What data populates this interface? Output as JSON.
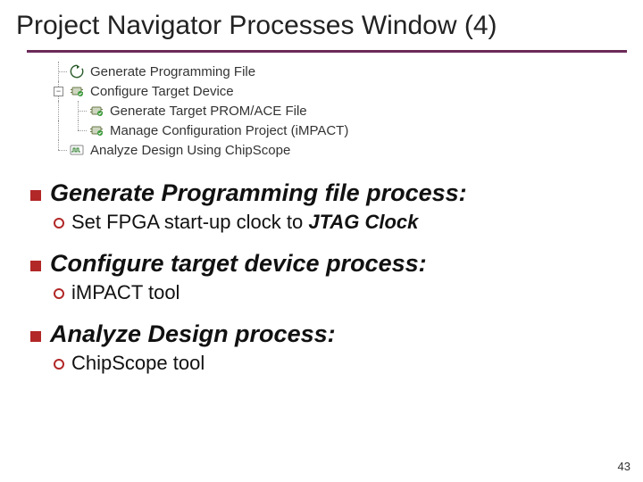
{
  "title": "Project Navigator Processes Window (4)",
  "tree": {
    "items": [
      {
        "label": "Generate Programming File",
        "icon": "cycle-icon"
      },
      {
        "label": "Configure Target Device",
        "icon": "chip-icon",
        "expanded": true,
        "children": [
          {
            "label": "Generate Target PROM/ACE File",
            "icon": "chip-icon"
          },
          {
            "label": "Manage Configuration Project (iMPACT)",
            "icon": "chip-icon"
          }
        ]
      },
      {
        "label": "Analyze Design Using ChipScope",
        "icon": "wave-icon"
      }
    ]
  },
  "bullets": [
    {
      "label_bold": "Generate Programming file process:",
      "sub": {
        "pre": "Set FPGA start-up clock to ",
        "bolditalic": "JTAG Clock"
      }
    },
    {
      "label_bold": "Configure target device process:",
      "sub": {
        "pre": "iMPACT tool",
        "bolditalic": ""
      }
    },
    {
      "label_bold": "Analyze Design process:",
      "sub": {
        "pre": "ChipScope tool",
        "bolditalic": ""
      }
    }
  ],
  "page_number": "43",
  "expander_glyph": "−"
}
